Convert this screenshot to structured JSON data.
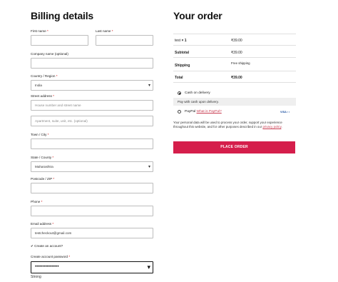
{
  "billing": {
    "title": "Billing details",
    "first_name": {
      "label": "First name",
      "req": "*",
      "value": ""
    },
    "last_name": {
      "label": "Last name",
      "req": "*",
      "value": ""
    },
    "company": {
      "label": "Company name (optional)",
      "value": ""
    },
    "country": {
      "label": "Country / Region",
      "req": "*",
      "value": "India"
    },
    "street": {
      "label": "Street address",
      "req": "*",
      "placeholder1": "House number and street name",
      "placeholder2": "Apartment, suite, unit, etc. (optional)"
    },
    "town": {
      "label": "Town / City",
      "req": "*",
      "value": ""
    },
    "state": {
      "label": "State / County",
      "req": "*",
      "value": "Maharashtra"
    },
    "postcode": {
      "label": "Postcode / ZIP",
      "req": "*",
      "value": ""
    },
    "phone": {
      "label": "Phone",
      "req": "*",
      "value": ""
    },
    "email": {
      "label": "Email address",
      "req": "*",
      "value": "testcheckout@gmail.com"
    },
    "create_account": {
      "label": "Create an account?",
      "check": "✔"
    },
    "password": {
      "label": "Create account password",
      "req": "*",
      "value": "••••••••••••••••"
    },
    "strength": "Strong"
  },
  "order": {
    "title": "Your order",
    "item": {
      "name": "test",
      "qty": "× 1",
      "price": "₹39.00"
    },
    "subtotal": {
      "label": "Subtotal",
      "value": "₹39.00"
    },
    "shipping": {
      "label": "Shipping",
      "value": "Free shipping"
    },
    "total": {
      "label": "Total",
      "value": "₹39.00"
    },
    "cod": {
      "label": "Cash on delivery",
      "desc": "Pay with cash upon delivery."
    },
    "paypal": {
      "label": "PayPal",
      "link": "What is PayPal?",
      "logos": "VISA ▪ ▪"
    },
    "privacy": {
      "text": "Your personal data will be used to process your order, support your experience throughout this website, and for other purposes described in our ",
      "link": "privacy policy",
      "end": "."
    },
    "place_order": "PLACE ORDER"
  }
}
